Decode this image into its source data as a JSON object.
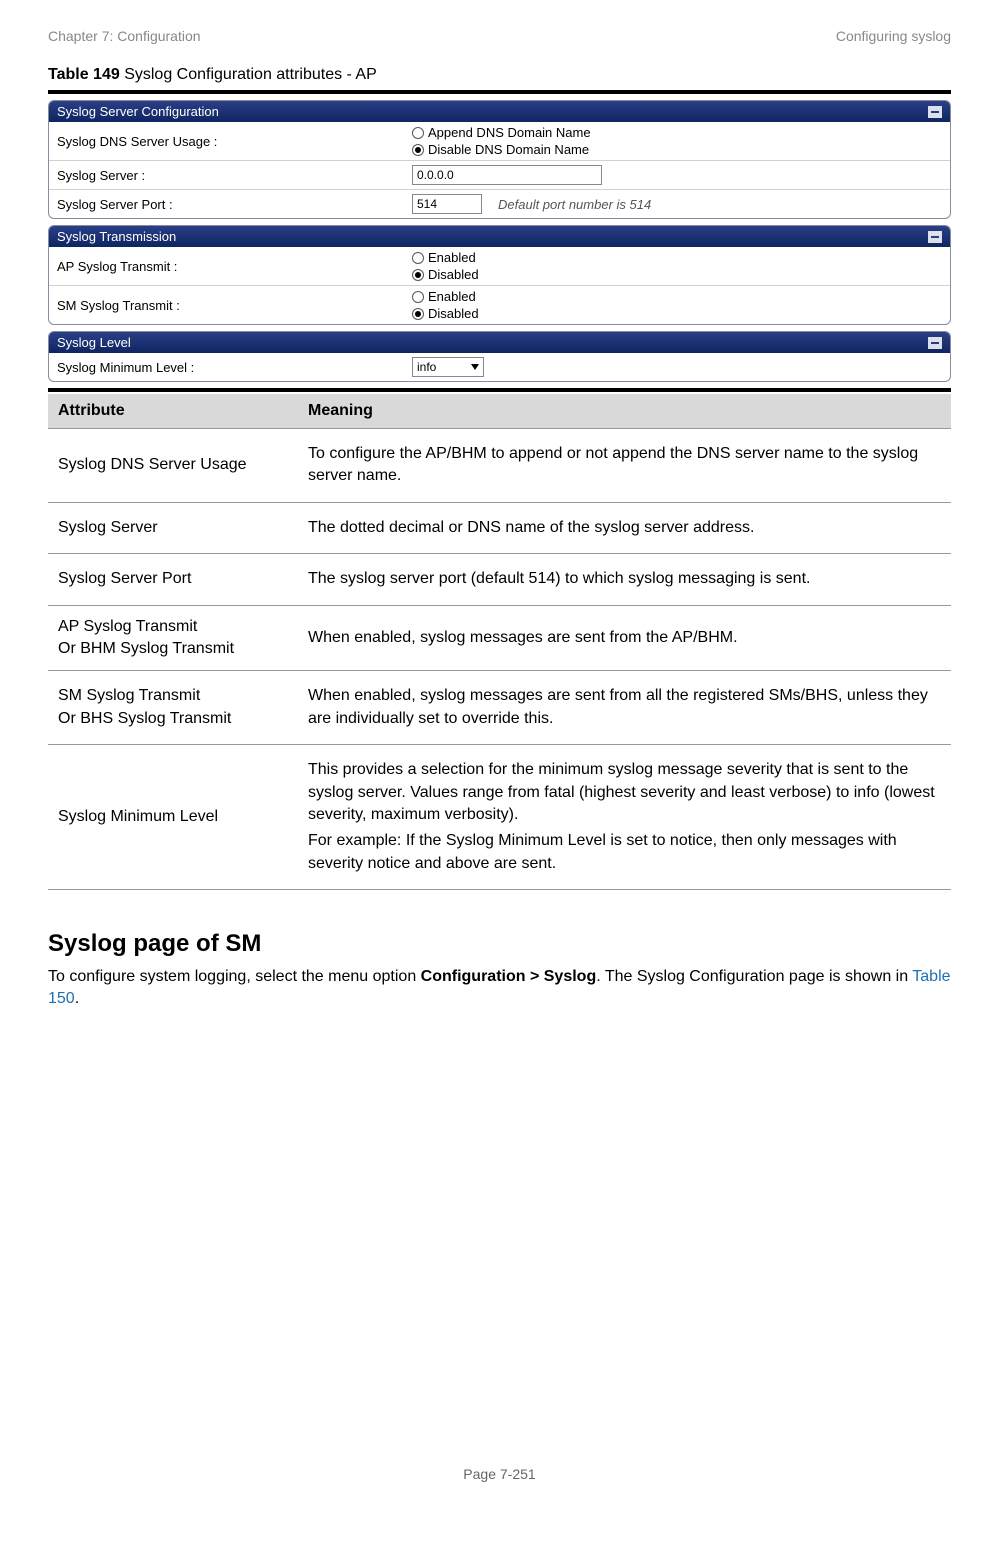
{
  "header": {
    "left": "Chapter 7:  Configuration",
    "right": "Configuring syslog"
  },
  "caption": {
    "bold": "Table 149",
    "rest": " Syslog Configuration attributes - AP"
  },
  "panels": {
    "server": {
      "title": "Syslog Server Configuration",
      "dns_label": "Syslog DNS Server Usage :",
      "dns_opt1": "Append DNS Domain Name",
      "dns_opt2": "Disable DNS Domain Name",
      "server_label": "Syslog Server :",
      "server_value": "0.0.0.0",
      "port_label": "Syslog Server Port :",
      "port_value": "514",
      "port_note": "Default port number is 514"
    },
    "transmission": {
      "title": "Syslog Transmission",
      "ap_label": "AP Syslog Transmit :",
      "sm_label": "SM Syslog Transmit :",
      "opt_enabled": "Enabled",
      "opt_disabled": "Disabled"
    },
    "level": {
      "title": "Syslog Level",
      "min_label": "Syslog Minimum Level :",
      "min_value": "info"
    }
  },
  "table": {
    "col1": "Attribute",
    "col2": "Meaning",
    "rows": [
      {
        "attr": "Syslog DNS Server Usage",
        "meaning": "To configure the AP/BHM to append or not append the DNS server name to the syslog server name."
      },
      {
        "attr": "Syslog Server",
        "meaning": "The dotted decimal or DNS name of the syslog server address."
      },
      {
        "attr": "Syslog Server Port",
        "meaning": "The syslog server port (default 514) to which syslog messaging is sent."
      },
      {
        "attr": "AP Syslog Transmit\nOr BHM Syslog Transmit",
        "meaning": "When enabled, syslog messages are sent from the AP/BHM."
      },
      {
        "attr": "SM Syslog Transmit\nOr BHS Syslog Transmit",
        "meaning": "When enabled, syslog messages are sent from all the registered SMs/BHS, unless they are individually set to override this."
      },
      {
        "attr": "Syslog Minimum Level",
        "meaning": "This provides a selection for the minimum syslog message severity that is sent to the syslog server. Values range from fatal (highest severity and least verbose) to info (lowest severity, maximum verbosity).\nFor example: If the Syslog Minimum Level is set to notice, then only messages with severity notice and above are sent."
      }
    ]
  },
  "section": {
    "title": "Syslog page of SM",
    "text_pre": "To configure system logging, select the menu option ",
    "text_bold": "Configuration > Syslog",
    "text_mid": ". The Syslog Configuration page is shown in ",
    "text_link": "Table 150",
    "text_post": "."
  },
  "footer": "Page 7-251"
}
